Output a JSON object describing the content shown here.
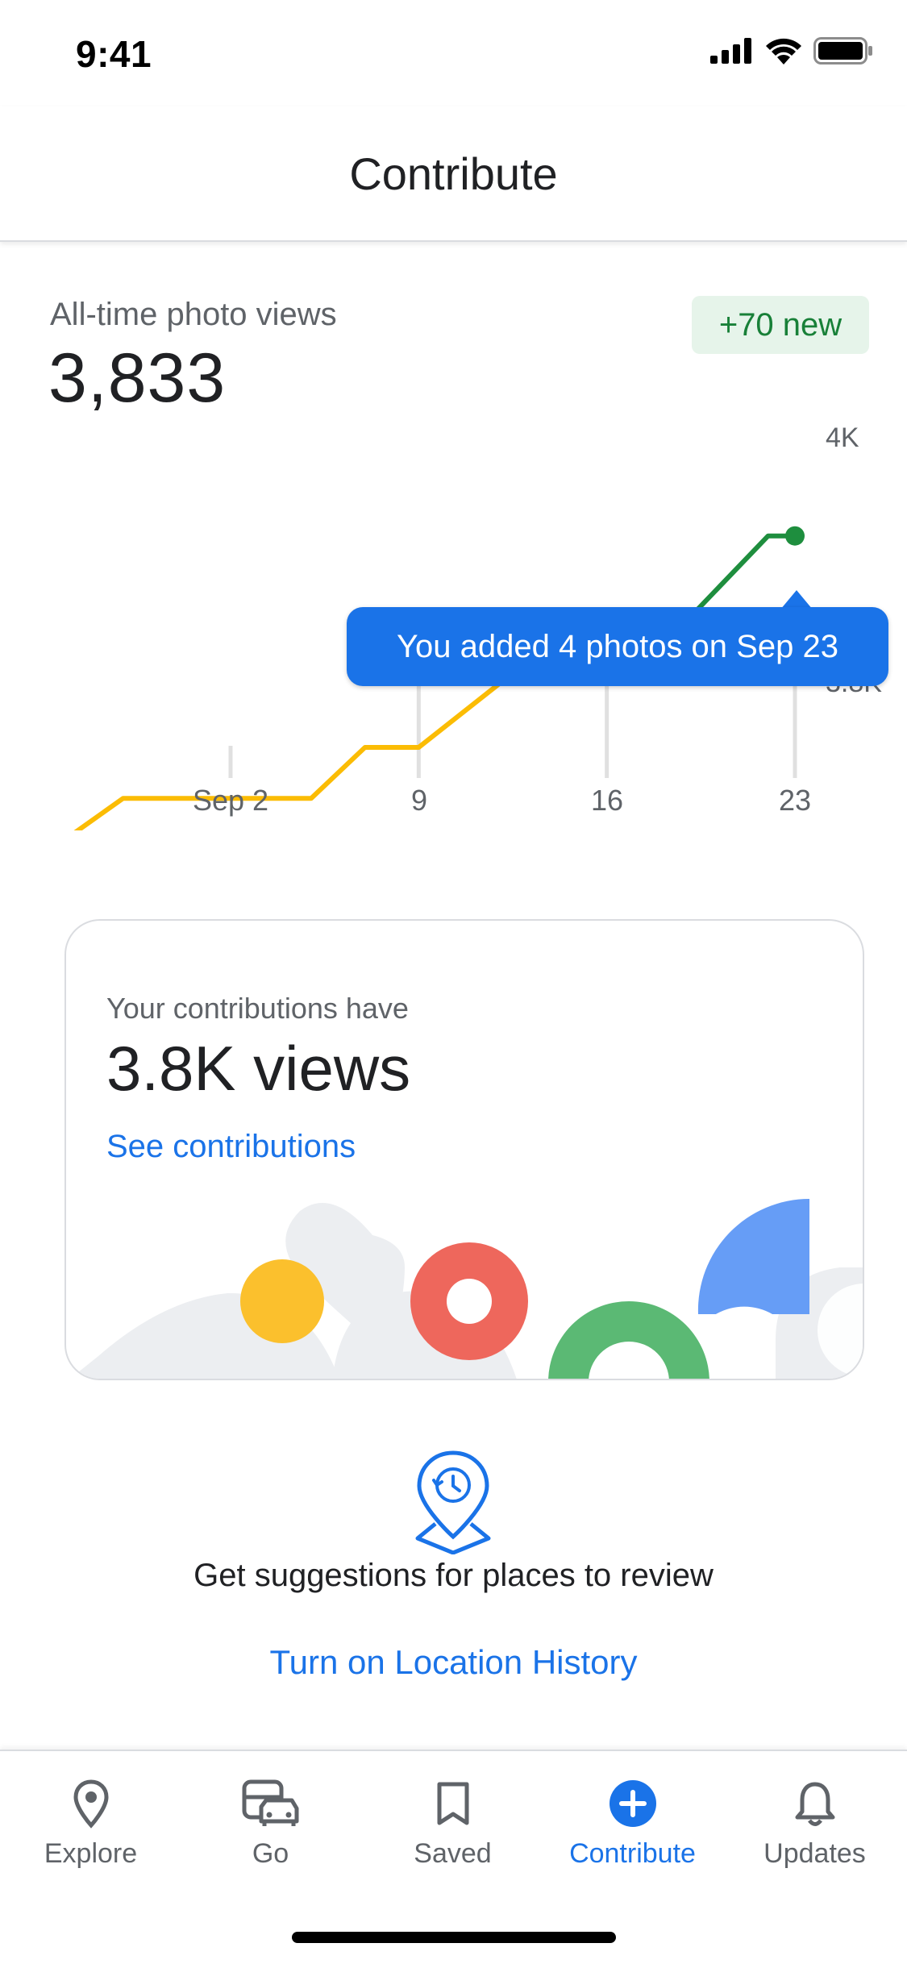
{
  "status_bar": {
    "time": "9:41"
  },
  "header": {
    "title": "Contribute"
  },
  "stats": {
    "label": "All-time photo views",
    "value": "3,833",
    "new_badge": "+70 new"
  },
  "chart_data": {
    "type": "line",
    "x_ticks": [
      "Sep 2",
      "9",
      "16",
      "23"
    ],
    "y_ticks": [
      "4K",
      "3.8K"
    ],
    "series": [
      {
        "color": "#fbbc04",
        "x": [
          "Aug 27",
          "Aug 29",
          "Sep 5",
          "Sep 7",
          "Sep 9",
          "Sep 12",
          "Sep 15",
          "Sep 17",
          "Sep 19"
        ],
        "values": [
          3740,
          3755,
          3755,
          3775,
          3775,
          3800,
          3825,
          3825,
          3825
        ]
      },
      {
        "color": "#1e8e3e",
        "x": [
          "Sep 17",
          "Sep 19",
          "Sep 22",
          "Sep 23"
        ],
        "values": [
          3825,
          3825,
          3858,
          3858
        ]
      }
    ],
    "highlight": {
      "x": "Sep 23",
      "color": "#1e8e3e"
    },
    "tooltip": "You added 4 photos on Sep 23"
  },
  "card": {
    "subtitle": "Your contributions have",
    "value": "3.8K views",
    "link": "See contributions"
  },
  "suggestions": {
    "icon": "location-history-pin-icon",
    "text": "Get suggestions for places to review",
    "link": "Turn on Location History"
  },
  "nav": {
    "items": [
      {
        "label": "Explore",
        "icon": "pin-icon"
      },
      {
        "label": "Go",
        "icon": "car-bus-icon"
      },
      {
        "label": "Saved",
        "icon": "bookmark-icon"
      },
      {
        "label": "Contribute",
        "icon": "plus-circle-icon",
        "active": true
      },
      {
        "label": "Updates",
        "icon": "bell-icon"
      }
    ]
  },
  "colors": {
    "accent": "#1a73e8",
    "green": "#188038",
    "yellow": "#fbbc04"
  }
}
